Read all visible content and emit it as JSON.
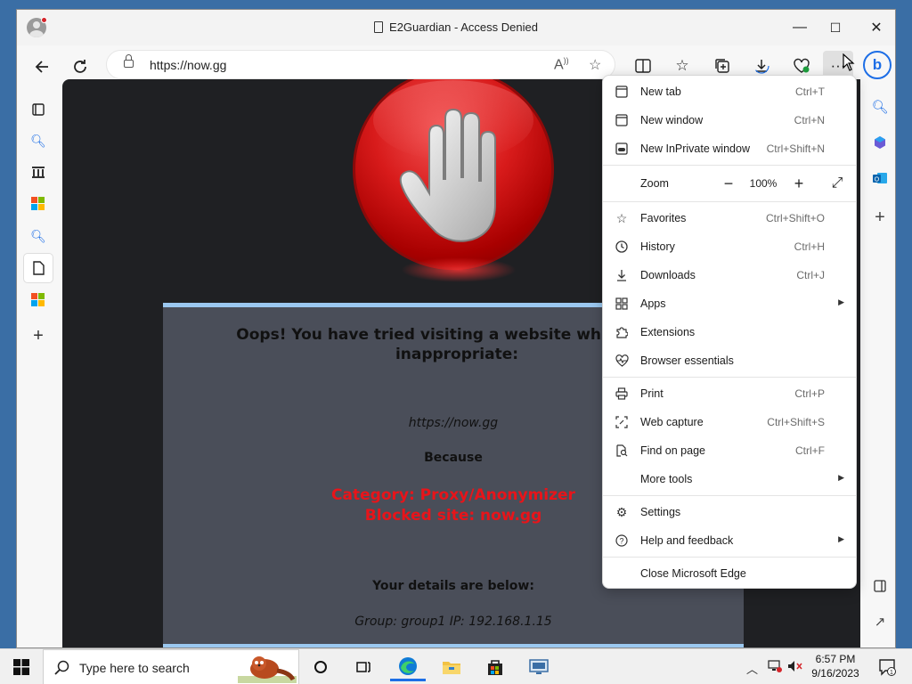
{
  "window": {
    "title": "E2Guardian - Access Denied",
    "minimize": "—",
    "maximize": "☐",
    "close": "✕"
  },
  "address_bar": {
    "url": "https://now.gg"
  },
  "page": {
    "heading": "Oops! You have tried visiting a website which has b                inappropriate:",
    "heading_line1": "Oops! You have tried visiting a website which has b",
    "heading_line2": "inappropriate:",
    "blocked_url": "https://now.gg",
    "because": "Because",
    "category": "Category: Proxy/Anonymizer",
    "blocked_site": "Blocked site: now.gg",
    "details_heading": "Your details are below:",
    "group_ip": "Group: group1   IP: 192.168.1.15"
  },
  "menu": {
    "items": [
      {
        "label": "New tab",
        "shortcut": "Ctrl+T",
        "icon": "new-tab-icon"
      },
      {
        "label": "New window",
        "shortcut": "Ctrl+N",
        "icon": "new-window-icon"
      },
      {
        "label": "New InPrivate window",
        "shortcut": "Ctrl+Shift+N",
        "icon": "inprivate-icon"
      },
      {
        "label": "Zoom",
        "value": "100%",
        "icon": ""
      },
      {
        "label": "Favorites",
        "shortcut": "Ctrl+Shift+O",
        "icon": "favorites-icon"
      },
      {
        "label": "History",
        "shortcut": "Ctrl+H",
        "icon": "history-icon"
      },
      {
        "label": "Downloads",
        "shortcut": "Ctrl+J",
        "icon": "download-icon"
      },
      {
        "label": "Apps",
        "shortcut": "",
        "icon": "apps-icon"
      },
      {
        "label": "Extensions",
        "shortcut": "",
        "icon": "extensions-icon"
      },
      {
        "label": "Browser essentials",
        "shortcut": "",
        "icon": "heart-pulse-icon"
      },
      {
        "label": "Print",
        "shortcut": "Ctrl+P",
        "icon": "print-icon"
      },
      {
        "label": "Web capture",
        "shortcut": "Ctrl+Shift+S",
        "icon": "web-capture-icon"
      },
      {
        "label": "Find on page",
        "shortcut": "Ctrl+F",
        "icon": "find-icon"
      },
      {
        "label": "More tools",
        "shortcut": "",
        "icon": ""
      },
      {
        "label": "Settings",
        "shortcut": "",
        "icon": "gear-icon"
      },
      {
        "label": "Help and feedback",
        "shortcut": "",
        "icon": "help-icon"
      },
      {
        "label": "Close Microsoft Edge",
        "shortcut": "",
        "icon": ""
      }
    ]
  },
  "taskbar": {
    "search_placeholder": "Type here to search",
    "time": "6:57 PM",
    "date": "9/16/2023",
    "notification_count": "1"
  },
  "colors": {
    "accent": "#1d6ee6",
    "blocked_red": "#e8141a",
    "panel_bg": "#4a4e59",
    "panel_border": "#9bc8f0"
  }
}
